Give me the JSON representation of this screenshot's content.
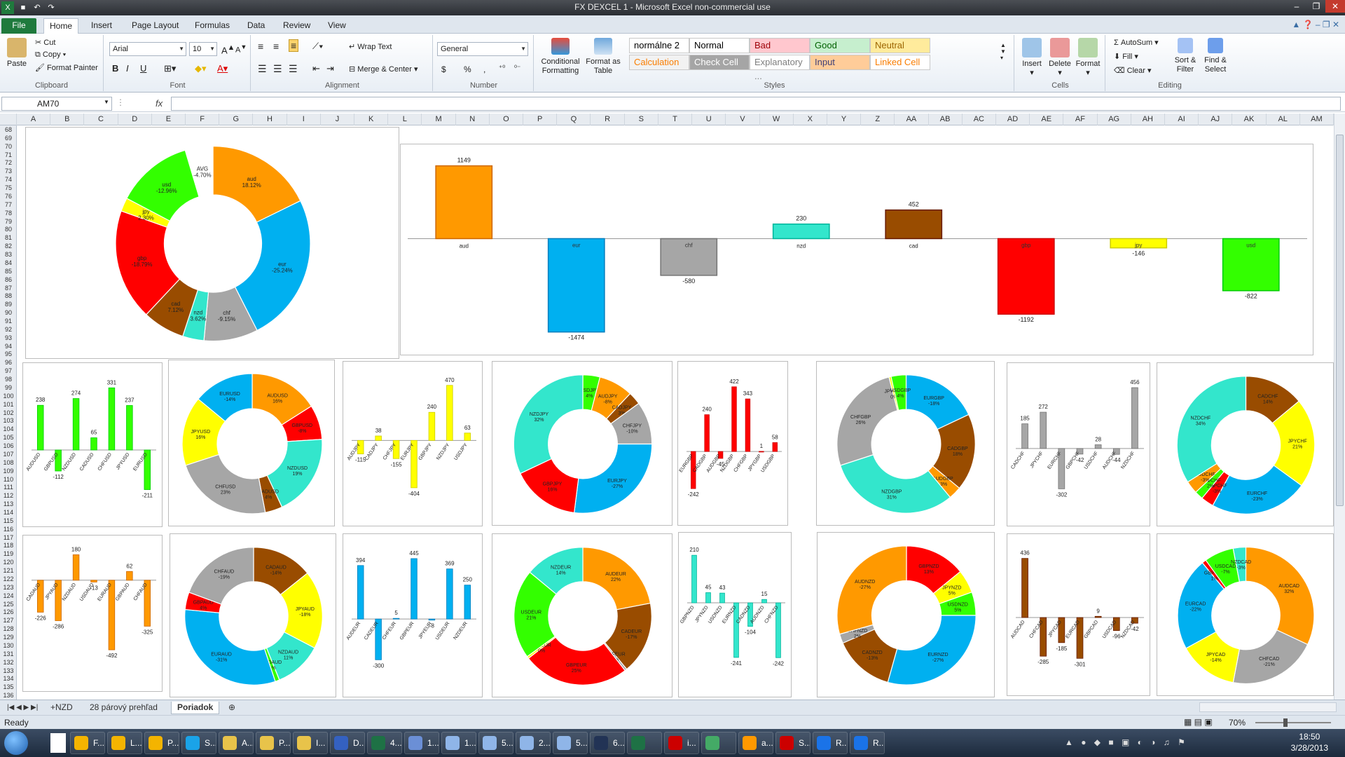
{
  "window": {
    "title": "FX DEXCEL 1 - Microsoft Excel non-commercial use"
  },
  "ribbon_tabs": [
    "File",
    "Home",
    "Insert",
    "Page Layout",
    "Formulas",
    "Data",
    "Review",
    "View"
  ],
  "clipboard": {
    "paste": "Paste",
    "cut": "Cut",
    "copy": "Copy",
    "format_painter": "Format Painter",
    "label": "Clipboard"
  },
  "font": {
    "name": "Arial",
    "size": "10",
    "label": "Font",
    "bold": "B",
    "italic": "I",
    "underline": "U"
  },
  "alignment": {
    "wrap": "Wrap Text",
    "merge": "Merge & Center",
    "label": "Alignment"
  },
  "number": {
    "format": "General",
    "label": "Number",
    "currency": "$",
    "percent": "%",
    "comma": ","
  },
  "styles_group": {
    "conditional": "Conditional Formatting",
    "format_table": "Format as Table",
    "label": "Styles",
    "cells": [
      {
        "name": "normálne 2",
        "bg": "#ffffff",
        "fg": "#000000"
      },
      {
        "name": "Normal",
        "bg": "#ffffff",
        "fg": "#000000"
      },
      {
        "name": "Bad",
        "bg": "#ffc7ce",
        "fg": "#9c0006"
      },
      {
        "name": "Good",
        "bg": "#c6efce",
        "fg": "#006100"
      },
      {
        "name": "Neutral",
        "bg": "#ffeb9c",
        "fg": "#9c6500"
      },
      {
        "name": "Calculation",
        "bg": "#f2f2f2",
        "fg": "#fa7d00"
      },
      {
        "name": "Check Cell",
        "bg": "#a5a5a5",
        "fg": "#ffffff"
      },
      {
        "name": "Explanatory ...",
        "bg": "#ffffff",
        "fg": "#7f7f7f"
      },
      {
        "name": "Input",
        "bg": "#ffcc99",
        "fg": "#3f3f76"
      },
      {
        "name": "Linked Cell",
        "bg": "#ffffff",
        "fg": "#fa7d00"
      }
    ]
  },
  "cells_group": {
    "insert": "Insert",
    "delete": "Delete",
    "format": "Format",
    "label": "Cells"
  },
  "editing": {
    "autosum": "AutoSum",
    "fill": "Fill",
    "clear": "Clear",
    "sort": "Sort & Filter",
    "find": "Find & Select",
    "label": "Editing",
    "sigma": "Σ"
  },
  "formula_bar": {
    "name_box": "AM70",
    "fx": "fx"
  },
  "columns": [
    "A",
    "B",
    "C",
    "D",
    "E",
    "F",
    "G",
    "H",
    "I",
    "J",
    "K",
    "L",
    "M",
    "N",
    "O",
    "P",
    "Q",
    "R",
    "S",
    "T",
    "U",
    "V",
    "W",
    "X",
    "Y",
    "Z",
    "AA",
    "AB",
    "AC",
    "AD",
    "AE",
    "AF",
    "AG",
    "AH",
    "AI",
    "AJ",
    "AK",
    "AL",
    "AM"
  ],
  "rows": {
    "first": 68,
    "last": 136
  },
  "sheet_tabs": [
    "+NZD",
    "28 párový prehľad",
    "Poriadok"
  ],
  "status": {
    "ready": "Ready",
    "zoom": "70%"
  },
  "taskbar": {
    "items": [
      "F...",
      "L...",
      "P...",
      "S...",
      "A...",
      "P...",
      "I...",
      "D...",
      "4...",
      "1...",
      "1...",
      "5...",
      "2...",
      "5...",
      "6...",
      "",
      "i...",
      "",
      "a...",
      "S...",
      "R...",
      "R..."
    ],
    "time": "18:50",
    "date": "3/28/2013"
  },
  "colors": {
    "aud": "#ff9900",
    "eur": "#00b0f0",
    "chf": "#a6a6a6",
    "nzd": "#33e6cc",
    "cad": "#994c00",
    "gbp": "#ff0000",
    "jpy": "#ffff00",
    "usd": "#33ff00",
    "avg": "#33ff00"
  },
  "chart_data": [
    {
      "type": "pie",
      "donut": true,
      "slices": [
        {
          "label": "aud",
          "value": 18.12,
          "display": "18.12%",
          "color": "aud"
        },
        {
          "label": "eur",
          "value": 25.24,
          "display": "-25.24%",
          "color": "eur"
        },
        {
          "label": "chf",
          "value": 9.15,
          "display": "-9.15%",
          "color": "chf"
        },
        {
          "label": "nzd",
          "value": 3.62,
          "display": "3.62%",
          "color": "nzd"
        },
        {
          "label": "cad",
          "value": 7.12,
          "display": "7.12%",
          "color": "cad"
        },
        {
          "label": "gbp",
          "value": 18.79,
          "display": "-18.79%",
          "color": "gbp"
        },
        {
          "label": "jpy",
          "value": 2.3,
          "display": "2.30%",
          "color": "jpy"
        },
        {
          "label": "usd",
          "value": 12.96,
          "display": "-12.96%",
          "color": "usd"
        },
        {
          "label": "AVG",
          "value": 4.7,
          "display": "-4.70%",
          "color": "white"
        }
      ]
    },
    {
      "type": "bar",
      "categories": [
        "aud",
        "eur",
        "chf",
        "nzd",
        "cad",
        "gbp",
        "jpy",
        "usd"
      ],
      "values": [
        1149,
        -1474,
        -580,
        230,
        452,
        -1192,
        -146,
        -822
      ],
      "ylim": [
        -1500,
        1200
      ],
      "colors": [
        "aud",
        "eur",
        "chf",
        "nzd",
        "cad",
        "gbp",
        "jpy",
        "usd"
      ]
    },
    {
      "type": "bar",
      "categories": [
        "AUDUSD",
        "GBPUSD",
        "NZDUSD",
        "CADUSD",
        "CHFUSD",
        "JPYUSD",
        "EURUSD"
      ],
      "values": [
        238,
        -112,
        274,
        65,
        331,
        237,
        -211
      ],
      "color": "usd"
    },
    {
      "type": "pie",
      "donut": true,
      "slices": [
        {
          "label": "AUDUSD",
          "value": 16,
          "display": "16%",
          "color": "aud"
        },
        {
          "label": "GBPUSD",
          "value": 8,
          "display": "-8%",
          "color": "gbp"
        },
        {
          "label": "NZDUSD",
          "value": 19,
          "display": "19%",
          "color": "nzd"
        },
        {
          "label": "CADUSD",
          "value": 4,
          "display": "4%",
          "color": "cad"
        },
        {
          "label": "CHFUSD",
          "value": 23,
          "display": "23%",
          "color": "chf"
        },
        {
          "label": "JPYUSD",
          "value": 16,
          "display": "16%",
          "color": "jpy"
        },
        {
          "label": "EURUSD",
          "value": 14,
          "display": "-14%",
          "color": "eur"
        }
      ]
    },
    {
      "type": "bar",
      "categories": [
        "AUDJPY",
        "CADJPY",
        "CHFJPY",
        "EURJPY",
        "GBPJPY",
        "NZDJPY",
        "USDJPY"
      ],
      "values": [
        -115,
        38,
        -155,
        -404,
        240,
        470,
        63
      ],
      "color": "jpy"
    },
    {
      "type": "pie",
      "donut": true,
      "slices": [
        {
          "label": "USDJPY",
          "value": 4,
          "display": "4%",
          "color": "usd"
        },
        {
          "label": "AUDJPY",
          "value": 8,
          "display": "-8%",
          "color": "aud"
        },
        {
          "label": "CADJPY",
          "value": 3,
          "display": "3%",
          "color": "cad"
        },
        {
          "label": "CHFJPY",
          "value": 10,
          "display": "-10%",
          "color": "chf"
        },
        {
          "label": "EURJPY",
          "value": 27,
          "display": "-27%",
          "color": "eur"
        },
        {
          "label": "GBPJPY",
          "value": 16,
          "display": "16%",
          "color": "gbp"
        },
        {
          "label": "NZDJPY",
          "value": 32,
          "display": "32%",
          "color": "nzd"
        }
      ]
    },
    {
      "type": "bar",
      "categories": [
        "EURGBP",
        "CADGBP",
        "AUDGBP",
        "NZDGBP",
        "CHFGBP",
        "JPYGBP",
        "USDGBP"
      ],
      "values": [
        -242,
        240,
        -45,
        422,
        343,
        1,
        58
      ],
      "color": "gbp"
    },
    {
      "type": "pie",
      "donut": true,
      "slices": [
        {
          "label": "EURGBP",
          "value": 18,
          "display": "-18%",
          "color": "eur"
        },
        {
          "label": "CADGBP",
          "value": 18,
          "display": "18%",
          "color": "cad"
        },
        {
          "label": "AUDGBP",
          "value": 3,
          "display": "-3%",
          "color": "aud"
        },
        {
          "label": "NZDGBP",
          "value": 31,
          "display": "31%",
          "color": "nzd"
        },
        {
          "label": "CHFGBP",
          "value": 26,
          "display": "26%",
          "color": "chf"
        },
        {
          "label": "JPYGBP",
          "value": 0.5,
          "display": "0%",
          "color": "jpy"
        },
        {
          "label": "USDGBP",
          "value": 3.5,
          "display": "4%",
          "color": "usd"
        }
      ]
    },
    {
      "type": "bar",
      "categories": [
        "CADCHF",
        "JPYCHF",
        "EURCHF",
        "GBPCHF",
        "USDCHF",
        "AUDCHF",
        "NZDCHF"
      ],
      "values": [
        185,
        272,
        -302,
        -42,
        28,
        -44,
        456
      ],
      "color": "chf"
    },
    {
      "type": "pie",
      "donut": true,
      "slices": [
        {
          "label": "CADCHF",
          "value": 14,
          "display": "14%",
          "color": "cad"
        },
        {
          "label": "JPYCHF",
          "value": 21,
          "display": "21%",
          "color": "jpy"
        },
        {
          "label": "EURCHF",
          "value": 23,
          "display": "-23%",
          "color": "eur"
        },
        {
          "label": "GBPCHF",
          "value": 3,
          "display": "-3%",
          "color": "gbp"
        },
        {
          "label": "USDCHF",
          "value": 2,
          "display": "2%",
          "color": "usd"
        },
        {
          "label": "AUDCHF",
          "value": 3,
          "display": "-3%",
          "color": "aud"
        },
        {
          "label": "NZDCHF",
          "value": 34,
          "display": "34%",
          "color": "nzd"
        }
      ]
    },
    {
      "type": "bar",
      "categories": [
        "CADAUD",
        "JPYAUD",
        "NZDAUD",
        "USDAUD",
        "EURAUD",
        "GBPAUD",
        "CHFAUD"
      ],
      "values": [
        -226,
        -286,
        180,
        -13,
        -492,
        62,
        -325
      ],
      "color": "aud"
    },
    {
      "type": "pie",
      "donut": true,
      "slices": [
        {
          "label": "CADAUD",
          "value": 14,
          "display": "-14%",
          "color": "cad"
        },
        {
          "label": "JPYAUD",
          "value": 18,
          "display": "-18%",
          "color": "jpy"
        },
        {
          "label": "NZDAUD",
          "value": 11,
          "display": "11%",
          "color": "nzd"
        },
        {
          "label": "USDAUD",
          "value": 1,
          "display": "-1%",
          "color": "usd"
        },
        {
          "label": "EURAUD",
          "value": 31,
          "display": "-31%",
          "color": "eur"
        },
        {
          "label": "GBPAUD",
          "value": 4,
          "display": "4%",
          "color": "gbp"
        },
        {
          "label": "CHFAUD",
          "value": 19,
          "display": "-19%",
          "color": "chf"
        }
      ]
    },
    {
      "type": "bar",
      "categories": [
        "AUDEUR",
        "CADEUR",
        "CHFEUR",
        "GBPEUR",
        "JPYEUR",
        "USDEUR",
        "NZDEUR"
      ],
      "values": [
        394,
        -300,
        5,
        445,
        -8,
        369,
        250
      ],
      "color": "eur"
    },
    {
      "type": "pie",
      "donut": true,
      "slices": [
        {
          "label": "AUDEUR",
          "value": 22,
          "display": "22%",
          "color": "aud"
        },
        {
          "label": "CADEUR",
          "value": 17,
          "display": "-17%",
          "color": "cad"
        },
        {
          "label": "CHFEUR",
          "value": 0.5,
          "display": "0%",
          "color": "chf"
        },
        {
          "label": "GBPEUR",
          "value": 25,
          "display": "25%",
          "color": "gbp"
        },
        {
          "label": "JPYEUR",
          "value": 0.5,
          "display": "0%",
          "color": "jpy"
        },
        {
          "label": "USDEUR",
          "value": 21,
          "display": "21%",
          "color": "usd"
        },
        {
          "label": "NZDEUR",
          "value": 14,
          "display": "14%",
          "color": "nzd"
        }
      ]
    },
    {
      "type": "bar",
      "categories": [
        "GBPNZD",
        "JPYNZD",
        "USDNZD",
        "EURNZD",
        "CADNZD",
        "AUDNZD",
        "CHFNZD"
      ],
      "values": [
        210,
        45,
        43,
        -241,
        -104,
        15,
        -242
      ],
      "color": "nzd"
    },
    {
      "type": "pie",
      "donut": true,
      "slices": [
        {
          "label": "GBPNZD",
          "value": 13,
          "display": "13%",
          "color": "gbp"
        },
        {
          "label": "JPYNZD",
          "value": 5,
          "display": "5%",
          "color": "jpy"
        },
        {
          "label": "USDNZD",
          "value": 5,
          "display": "5%",
          "color": "usd"
        },
        {
          "label": "EURNZD",
          "value": 27,
          "display": "-27%",
          "color": "eur"
        },
        {
          "label": "CADNZD",
          "value": 13,
          "display": "-13%",
          "color": "cad"
        },
        {
          "label": "CHFNZD",
          "value": 2,
          "display": "2%",
          "color": "chf"
        },
        {
          "label": "AUDNZD",
          "value": 27,
          "display": "-27%",
          "color": "aud"
        }
      ]
    },
    {
      "type": "bar",
      "categories": [
        "AUDCAD",
        "CHFCAD",
        "JPYCAD",
        "EURCAD",
        "GBPCAD",
        "USDCAD",
        "NZDCAD"
      ],
      "values": [
        436,
        -285,
        -185,
        -301,
        9,
        -96,
        -42
      ],
      "color": "cad"
    },
    {
      "type": "pie",
      "donut": true,
      "slices": [
        {
          "label": "AUDCAD",
          "value": 32,
          "display": "32%",
          "color": "aud"
        },
        {
          "label": "CHFCAD",
          "value": 21,
          "display": "-21%",
          "color": "chf"
        },
        {
          "label": "JPYCAD",
          "value": 14,
          "display": "-14%",
          "color": "jpy"
        },
        {
          "label": "EURCAD",
          "value": 22,
          "display": "-22%",
          "color": "eur"
        },
        {
          "label": "GBPCAD",
          "value": 1,
          "display": "1%",
          "color": "gbp"
        },
        {
          "label": "USDCAD",
          "value": 7,
          "display": "-7%",
          "color": "usd"
        },
        {
          "label": "NZDCAD",
          "value": 3,
          "display": "-3%",
          "color": "nzd"
        }
      ]
    }
  ]
}
